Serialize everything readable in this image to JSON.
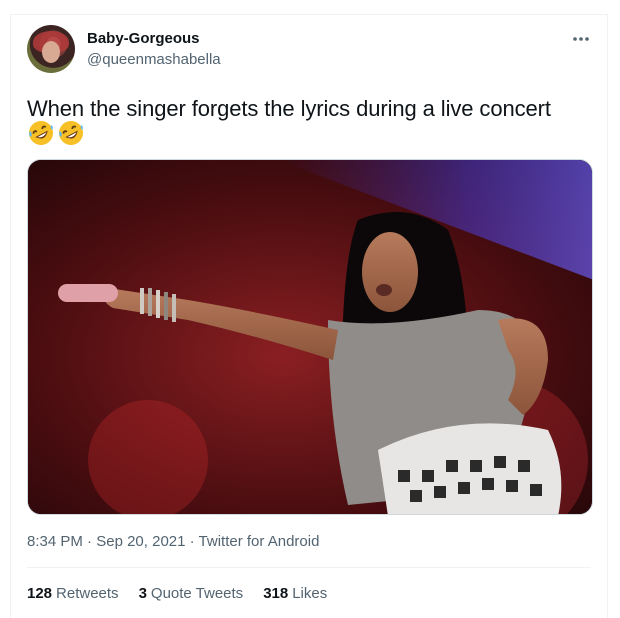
{
  "tweet": {
    "display_name": "Baby-Gorgeous",
    "handle": "@queenmashabella",
    "text": "When the singer forgets the lyrics during a live concert",
    "emoji_icons": [
      "rolling-on-floor-laughing-icon",
      "rolling-on-floor-laughing-icon"
    ],
    "time": "8:34 PM",
    "date": "Sep 20, 2021",
    "source": "Twitter for Android",
    "separator": "·"
  },
  "stats": {
    "retweets_count": "128",
    "retweets_label": "Retweets",
    "quote_count": "3",
    "quote_label": "Quote Tweets",
    "likes_count": "318",
    "likes_label": "Likes"
  },
  "colors": {
    "text_primary": "#0f1419",
    "text_secondary": "#536471",
    "border": "#eff3f4"
  }
}
